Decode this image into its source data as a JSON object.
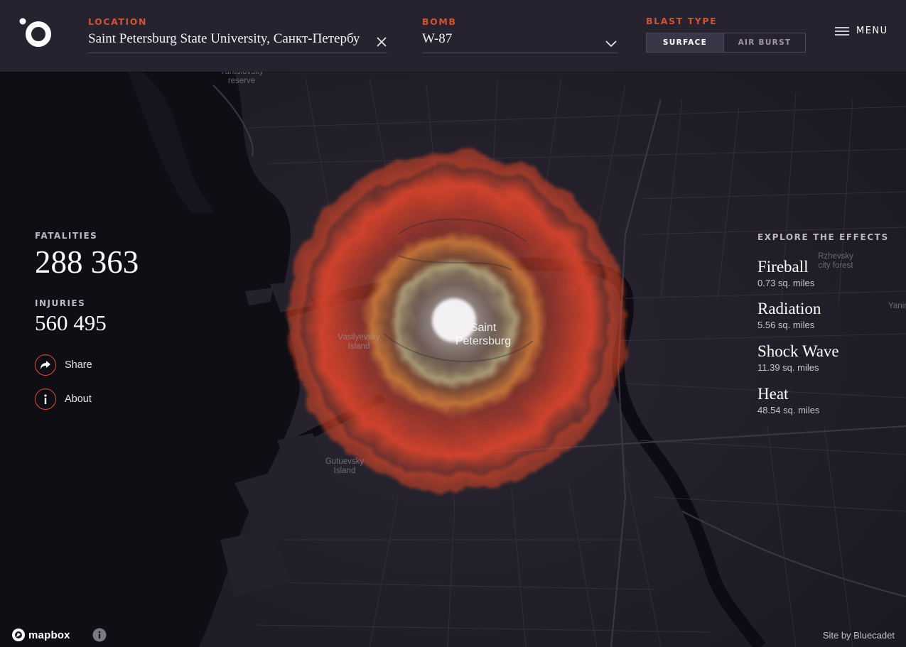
{
  "header": {
    "location_label": "LOCATION",
    "location_value": "Saint Petersburg State University, Санкт-Петербу",
    "bomb_label": "BOMB",
    "bomb_value": "W-87",
    "blast_type_label": "BLAST TYPE",
    "blast_options": [
      "SURFACE",
      "AIR BURST"
    ],
    "blast_selected": "SURFACE",
    "menu_label": "MENU"
  },
  "stats": {
    "fatalities_label": "FATALITIES",
    "fatalities_value": "288 363",
    "injuries_label": "INJURIES",
    "injuries_value": "560 495"
  },
  "actions": {
    "share_label": "Share",
    "about_label": "About"
  },
  "effects": {
    "title": "EXPLORE THE EFFECTS",
    "items": [
      {
        "name": "Fireball",
        "area": "0.73 sq. miles"
      },
      {
        "name": "Radiation",
        "area": "5.56 sq. miles"
      },
      {
        "name": "Shock Wave",
        "area": "11.39 sq. miles"
      },
      {
        "name": "Heat",
        "area": "48.54 sq. miles"
      }
    ]
  },
  "map": {
    "city_label_line1": "Saint",
    "city_label_line2": "Petersburg",
    "labels": [
      {
        "line1": "Yuntolovsky",
        "line2": "reserve"
      },
      {
        "line1": "Vasilyevsky",
        "line2": "Island"
      },
      {
        "line1": "Gutuevsky",
        "line2": "Island"
      },
      {
        "line1": "Rzhevsky",
        "line2": "city forest"
      },
      {
        "line1": "Yanin",
        "line2": ""
      }
    ],
    "colors": {
      "heat": "#d9442b",
      "shockwave": "#c8783a",
      "radiation": "#a9a37a",
      "fireball": "#f3f1f4"
    }
  },
  "footer": {
    "mapbox_label": "mapbox",
    "credit": "Site by Bluecadet"
  }
}
